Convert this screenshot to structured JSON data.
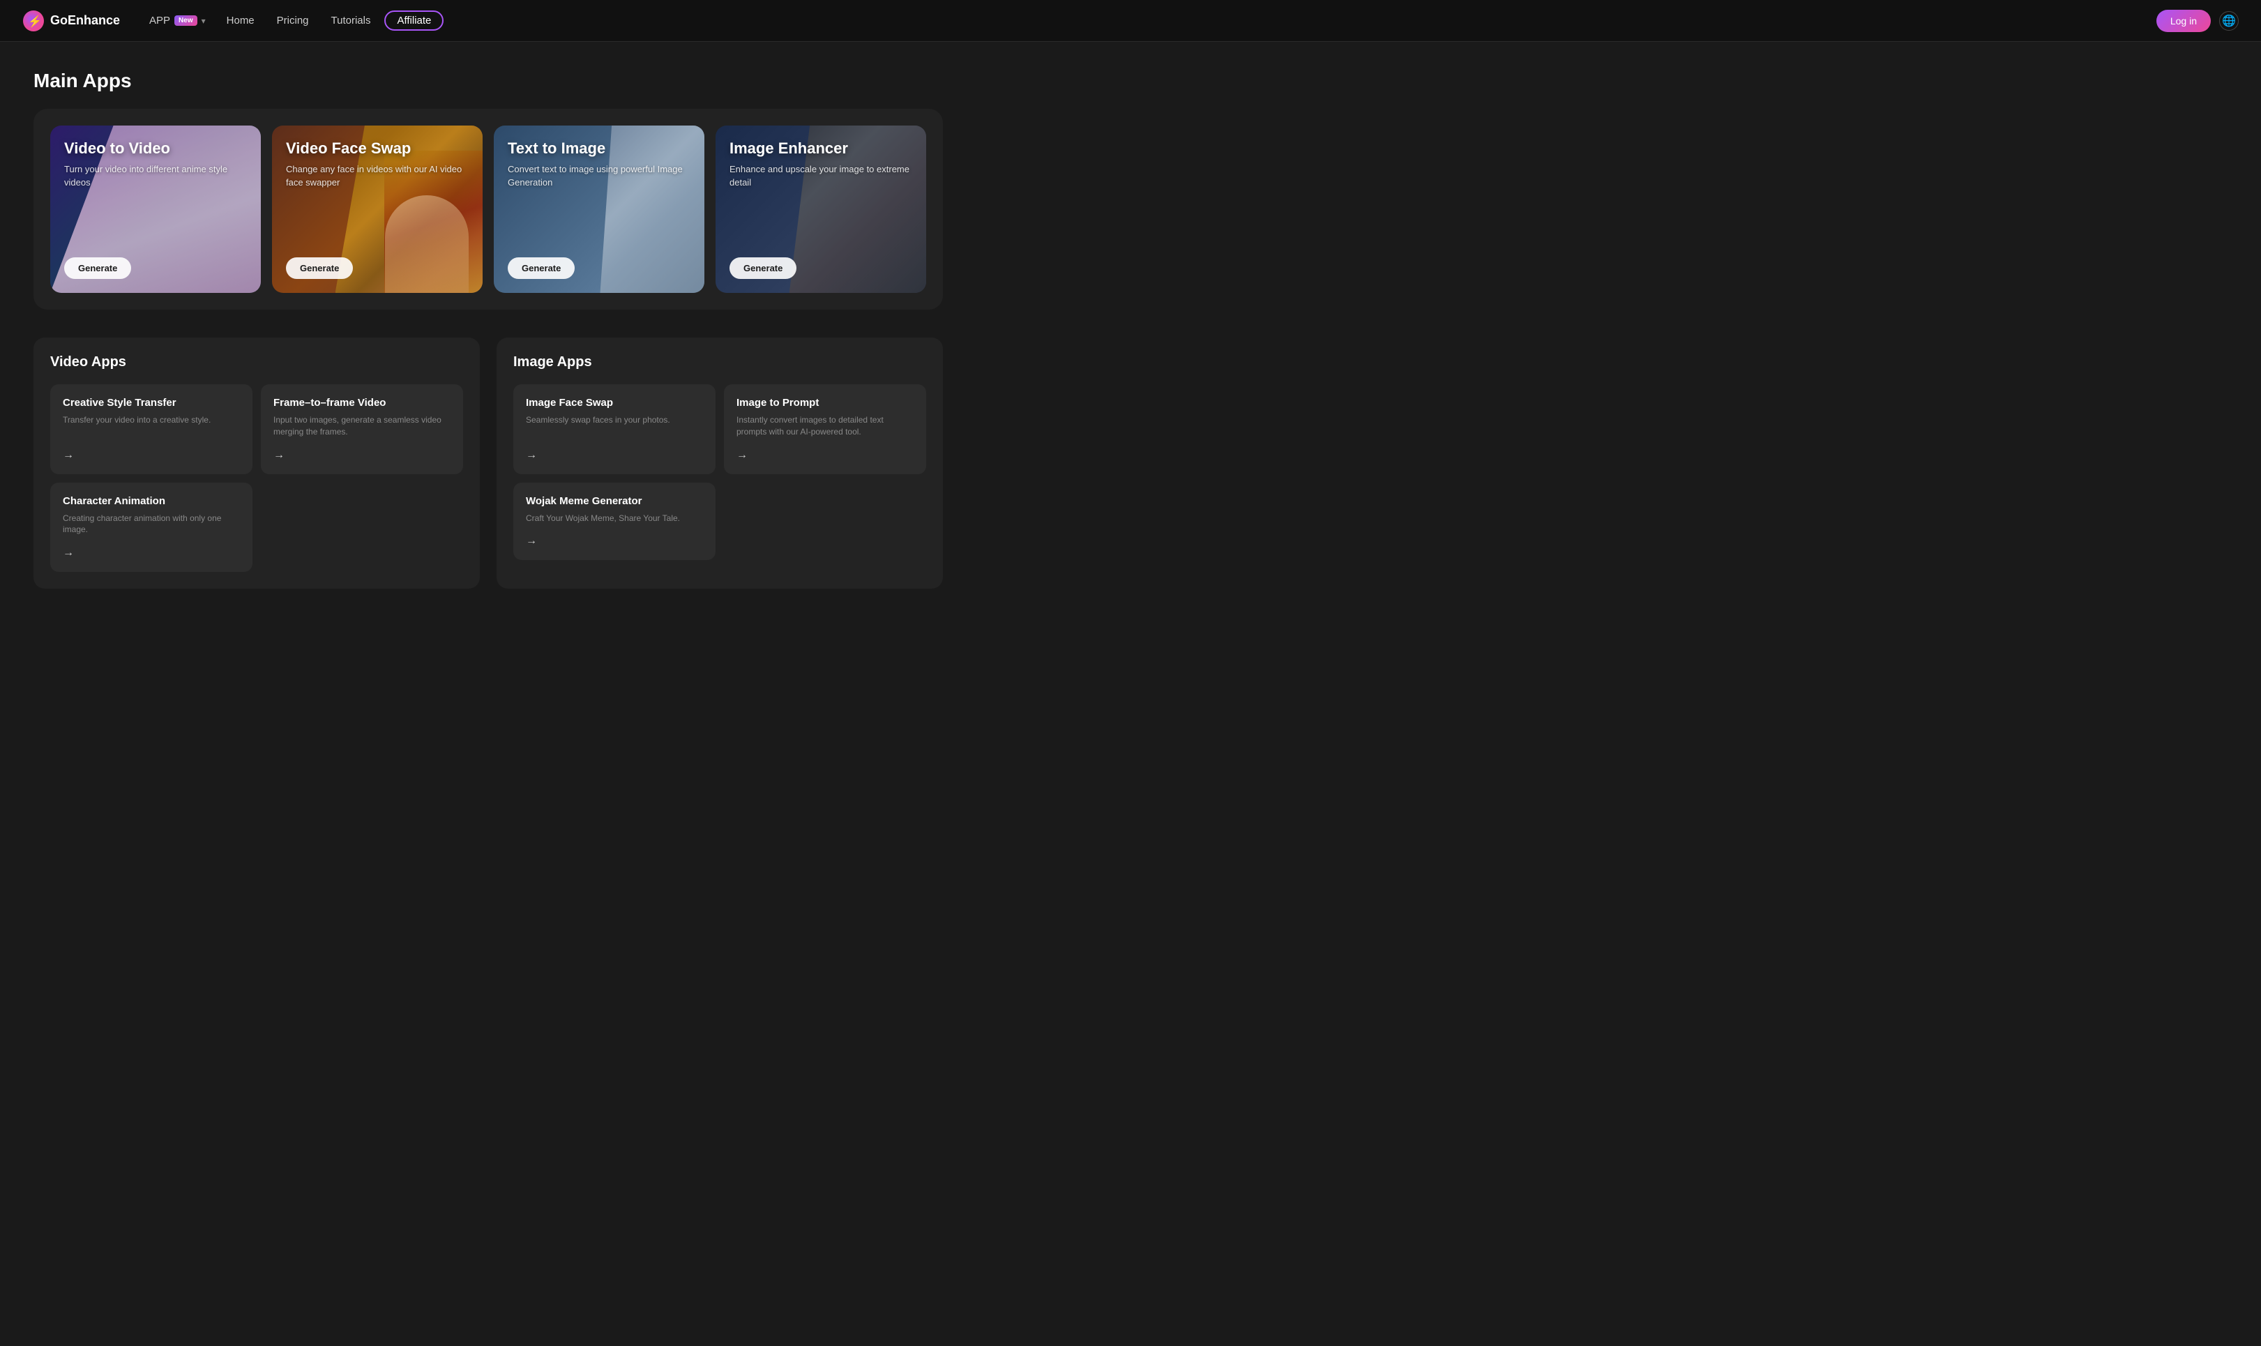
{
  "nav": {
    "logo_text": "GoEnhance",
    "app_label": "APP",
    "app_badge": "New",
    "home_label": "Home",
    "pricing_label": "Pricing",
    "tutorials_label": "Tutorials",
    "affiliate_label": "Affiliate",
    "login_label": "Log in"
  },
  "main_apps": {
    "section_title": "Main Apps",
    "cards": [
      {
        "title": "Video to Video",
        "description": "Turn your video into different anime style videos",
        "btn_label": "Generate",
        "theme": "v2v"
      },
      {
        "title": "Video Face Swap",
        "description": "Change any face in videos with our AI video face swapper",
        "btn_label": "Generate",
        "theme": "vfs"
      },
      {
        "title": "Text to Image",
        "description": "Convert text to image using powerful Image Generation",
        "btn_label": "Generate",
        "theme": "t2i"
      },
      {
        "title": "Image Enhancer",
        "description": "Enhance and upscale your image to extreme detail",
        "btn_label": "Generate",
        "theme": "ie"
      }
    ]
  },
  "video_apps": {
    "section_title": "Video Apps",
    "cards": [
      {
        "title": "Creative Style Transfer",
        "description": "Transfer your video into a creative style.",
        "arrow": "→"
      },
      {
        "title": "Frame–to–frame Video",
        "description": "Input two images, generate a seamless video merging the frames.",
        "arrow": "→"
      },
      {
        "title": "Character Animation",
        "description": "Creating character animation with only one image.",
        "arrow": "→"
      }
    ]
  },
  "image_apps": {
    "section_title": "Image Apps",
    "cards": [
      {
        "title": "Image Face Swap",
        "description": "Seamlessly swap faces in your photos.",
        "arrow": "→"
      },
      {
        "title": "Image to Prompt",
        "description": "Instantly convert images to detailed text prompts with our AI-powered tool.",
        "arrow": "→"
      },
      {
        "title": "Wojak Meme Generator",
        "description": "Craft Your Wojak Meme, Share Your Tale.",
        "arrow": "→"
      }
    ]
  }
}
